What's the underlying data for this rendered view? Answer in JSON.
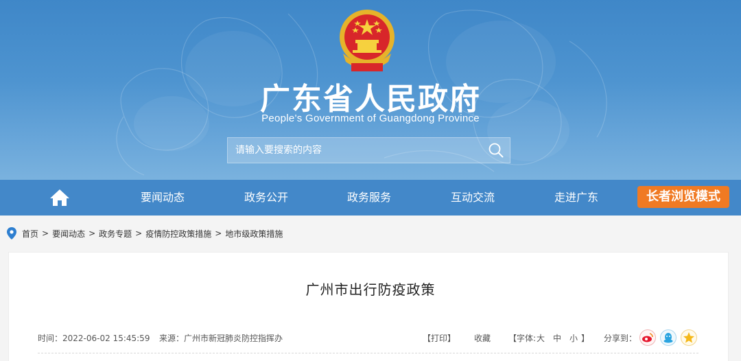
{
  "header": {
    "title": "广东省人民政府",
    "subtitle": "People's Government of Guangdong Province",
    "emblem_icon": "national-emblem-icon"
  },
  "search": {
    "placeholder": "请输入要搜索的内容",
    "icon": "search-icon"
  },
  "nav": {
    "home_icon": "home-icon",
    "items": [
      {
        "label": "要闻动态"
      },
      {
        "label": "政务公开"
      },
      {
        "label": "政务服务"
      },
      {
        "label": "互动交流"
      },
      {
        "label": "走进广东"
      }
    ],
    "elder_mode_label": "长者浏览模式"
  },
  "breadcrumb": {
    "icon": "location-pin-icon",
    "items": [
      {
        "label": "首页"
      },
      {
        "label": "要闻动态"
      },
      {
        "label": "政务专题"
      },
      {
        "label": "疫情防控政策措施"
      },
      {
        "label": "地市级政策措施"
      }
    ],
    "separator": ">"
  },
  "article": {
    "title": "广州市出行防疫政策",
    "time_text": "时间：2022-06-02 15:45:59",
    "source_text": "来源：广州市新冠肺炎防控指挥办",
    "print_label": "【打印】",
    "favorite_label": "收藏",
    "font_size_prefix": "【字体:",
    "font_large": "大",
    "font_medium": "中",
    "font_small": "小",
    "font_size_suffix": "】",
    "share_label": "分享到："
  },
  "colors": {
    "banner": "#4a8fcd",
    "navbar": "#4388c9",
    "elder_button": "#f07a23",
    "weibo": "#e6162d",
    "qq": "#2aa4e0",
    "qzone": "#f5b818"
  },
  "share_icons": [
    "weibo-icon",
    "qq-icon",
    "qzone-icon"
  ]
}
